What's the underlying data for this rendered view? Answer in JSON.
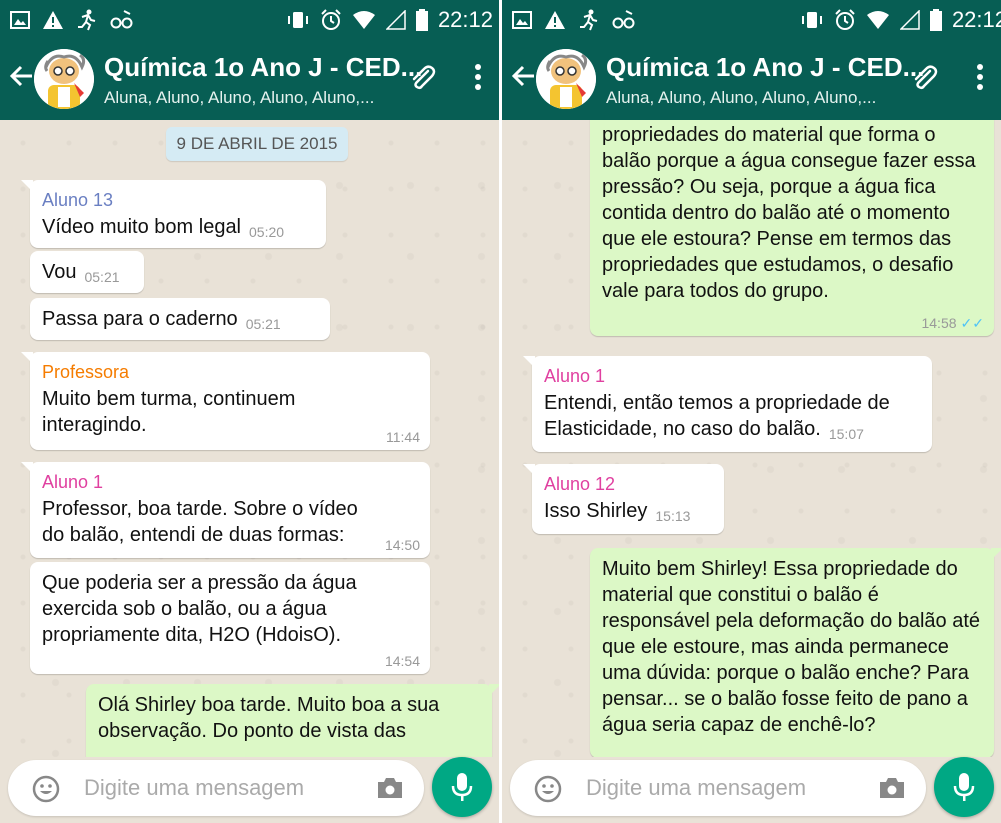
{
  "status_bar": {
    "time": "22:12"
  },
  "chat_header": {
    "title": "Química 1o Ano J - CED...",
    "subtitle": "Aluna, Aluno, Aluno, Aluno, Aluno,..."
  },
  "input_bar": {
    "placeholder": "Digite uma mensagem"
  },
  "colors": {
    "header": "#075e54",
    "outgoing_bubble": "#dcf8c6",
    "incoming_bubble": "#ffffff",
    "professora_name": "#f57c00",
    "aluno1_name": "#e040a0",
    "aluno13_name": "#6a7fc2",
    "aluno12_name": "#e040a0",
    "mic_button": "#00a884"
  },
  "left_panel": {
    "date_chip": "9 DE ABRIL DE 2015",
    "messages": [
      {
        "sender": "Aluno 13",
        "text": "Vídeo muito bom legal",
        "time": "05:20"
      },
      {
        "text": "Vou",
        "time": "05:21"
      },
      {
        "text": "Passa para o caderno",
        "time": "05:21"
      },
      {
        "sender": "Professora",
        "text": "Muito bem turma, continuem interagindo.",
        "time": "11:44"
      },
      {
        "sender": "Aluno 1",
        "text": "Professor, boa tarde. Sobre o vídeo do balão, entendi de duas formas:",
        "time": "14:50"
      },
      {
        "text": "Que poderia ser a pressão da água exercida sob o balão, ou a água propriamente dita, H2O (HdoisO).",
        "time": "14:54"
      },
      {
        "text": "Olá Shirley boa tarde. Muito boa a sua observação. Do ponto de vista das"
      }
    ]
  },
  "right_panel": {
    "messages": [
      {
        "text": "propriedades do material que forma o balão porque a água consegue fazer essa pressão? Ou seja, porque a água fica contida dentro do balão até o momento que ele estoura? Pense em termos das propriedades que estudamos, o desafio vale para todos do grupo.",
        "time": "14:58"
      },
      {
        "sender": "Aluno 1",
        "text": "Entendi, então temos a propriedade de Elasticidade, no caso do balão.",
        "time": "15:07"
      },
      {
        "sender": "Aluno 12",
        "text": "Isso Shirley",
        "time": "15:13"
      },
      {
        "text": "Muito bem Shirley! Essa propriedade do material que constitui o balão é responsável pela deformação do balão até que ele estoure, mas ainda permanece uma dúvida: porque o balão enche? Para pensar... se o balão fosse feito de pano a água seria capaz de enchê-lo?"
      }
    ]
  }
}
